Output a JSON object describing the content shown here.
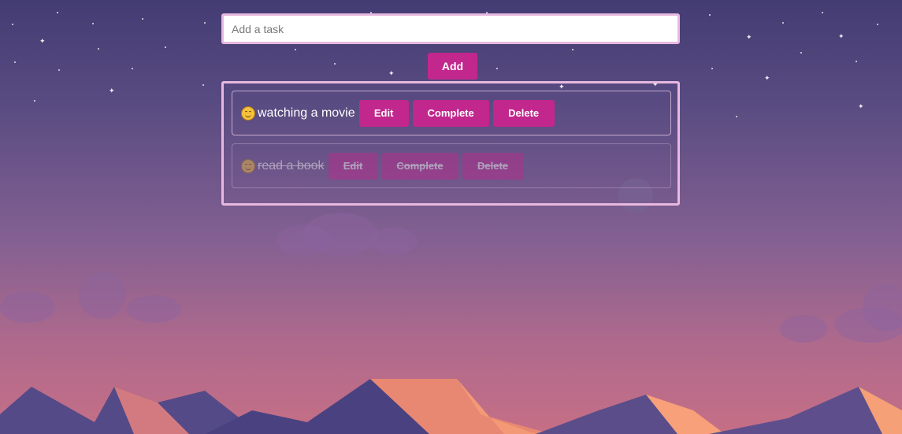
{
  "input": {
    "placeholder": "Add a task",
    "value": ""
  },
  "add_button": {
    "label": "Add"
  },
  "tasks": [
    {
      "text": "watching a movie",
      "completed": false,
      "edit_label": "Edit",
      "complete_label": "Complete",
      "delete_label": "Delete",
      "icon": "smiling-face-icon"
    },
    {
      "text": "read a book",
      "completed": true,
      "edit_label": "Edit",
      "complete_label": "Complete",
      "delete_label": "Delete",
      "icon": "smiling-face-icon"
    }
  ],
  "colors": {
    "accent": "#c1278c",
    "border": "#e8b8e0",
    "sky_top": "#433c73",
    "sky_bottom": "#c66f86"
  },
  "background_icons": [
    "star-icon",
    "moon-icon",
    "cloud-icon",
    "mountain-icon"
  ]
}
